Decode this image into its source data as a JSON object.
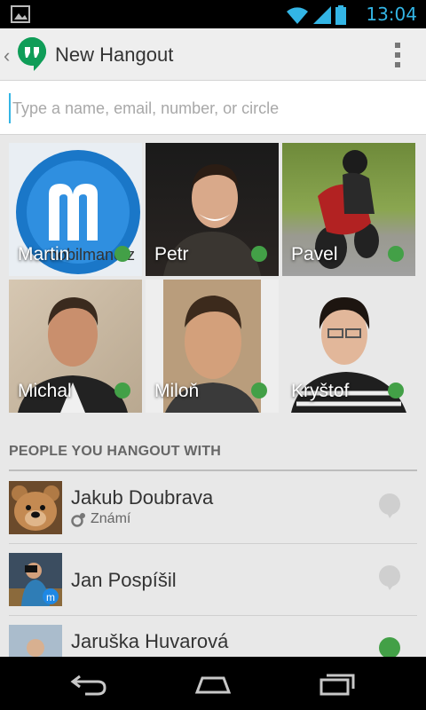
{
  "status_bar": {
    "time": "13:04",
    "icons": [
      "image-notification-icon",
      "wifi-icon",
      "signal-icon",
      "battery-icon"
    ],
    "accent": "#33b5e5"
  },
  "action_bar": {
    "title": "New Hangout",
    "logo": "hangouts-logo-icon"
  },
  "search": {
    "placeholder": "Type a name, email, number, or circle",
    "value": ""
  },
  "contacts_grid": [
    {
      "name": "Martin",
      "online": true
    },
    {
      "name": "Petr",
      "online": true
    },
    {
      "name": "Pavel",
      "online": true
    },
    {
      "name": "Michal",
      "online": true
    },
    {
      "name": "Miloň",
      "online": true
    },
    {
      "name": "Kryštof",
      "online": true
    }
  ],
  "section": {
    "title": "PEOPLE YOU HANGOUT WITH"
  },
  "people": [
    {
      "name": "Jakub Doubrava",
      "subtitle": "Známí",
      "online": false
    },
    {
      "name": "Jan Pospíšil",
      "subtitle": "",
      "online": false
    },
    {
      "name": "Jaruška Huvarová",
      "subtitle": "",
      "online": true
    }
  ],
  "colors": {
    "online_green": "#43a047",
    "offline_gray": "#cfcfcf",
    "hangouts_green": "#0f9d58"
  }
}
